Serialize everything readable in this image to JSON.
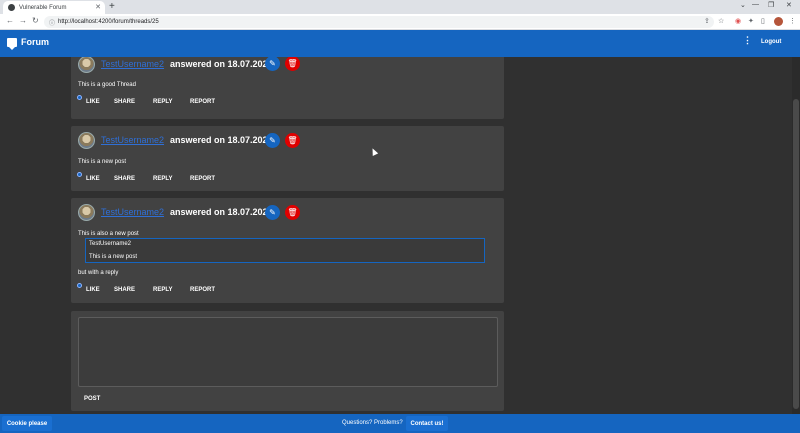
{
  "browser": {
    "tab_title": "Vulnerable Forum",
    "url": "http://localhost:4200/forum/threads/25"
  },
  "appbar": {
    "title": "Forum",
    "logout_label": "Logout"
  },
  "posts": [
    {
      "author": "TestUsername2",
      "meta": "answered on 18.07.2022",
      "text": "This is a good Thread",
      "actions": [
        "LIKE",
        "SHARE",
        "REPLY",
        "REPORT"
      ]
    },
    {
      "author": "TestUsername2",
      "meta": "answered on 18.07.2022",
      "text": "This is a new post",
      "actions": [
        "LIKE",
        "SHARE",
        "REPLY",
        "REPORT"
      ]
    },
    {
      "author": "TestUsername2",
      "meta": "answered on 18.07.2022",
      "text": "This is also a new post",
      "quote": {
        "author": "TestUsername2",
        "text": "This is a new post"
      },
      "text_after": "but with a reply",
      "actions": [
        "LIKE",
        "SHARE",
        "REPLY",
        "REPORT"
      ]
    }
  ],
  "composer": {
    "value": "",
    "post_label": "POST"
  },
  "footer": {
    "cookie_label": "Cookie please",
    "question_text": "Questions? Problems?",
    "contact_label": "Contact us!"
  },
  "colors": {
    "primary": "#1565c0",
    "delete": "#e00000",
    "card": "#424242",
    "background": "#303030"
  }
}
